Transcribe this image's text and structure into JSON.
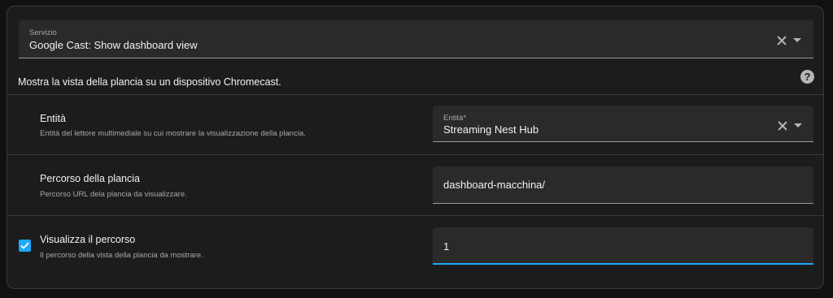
{
  "service": {
    "label": "Servizio",
    "value": "Google Cast: Show dashboard view"
  },
  "service_description": "Mostra la vista della plancia su un dispositivo Chromecast.",
  "help_icon": "question-mark-icon",
  "fields": [
    {
      "title": "Entità",
      "subtitle": "Entità del lettore multimediale su cui mostrare la visualizzazione della plancia.",
      "input_label": "Entità*",
      "input_value": "Streaming Nest Hub"
    },
    {
      "title": "Percorso della plancia",
      "subtitle": "Percorso URL dela plancia da visualizzare.",
      "input_value": "dashboard-macchina/"
    },
    {
      "title": "Visualizza il percorso",
      "subtitle": "Il percorso della vista della plancia da mostrare.",
      "input_value": "1",
      "checked": true
    }
  ],
  "colors": {
    "accent": "#1ea7fd",
    "card_background": "#1c1c1c",
    "field_background": "#2a2a2a",
    "page_background": "#111111"
  }
}
